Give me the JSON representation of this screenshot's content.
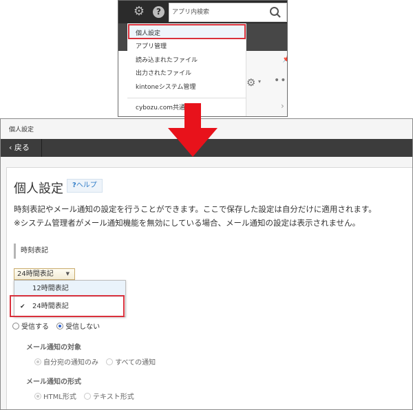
{
  "menu_snapshot": {
    "search_placeholder": "アプリ内検索",
    "items": [
      "個人設定",
      "アプリ管理",
      "読み込まれたファイル",
      "出力されたファイル",
      "kintoneシステム管理"
    ],
    "footer_item": "cybozu.com共通管理",
    "highlight_color": "#d9303b"
  },
  "page": {
    "title": "個人設定",
    "back_label": "戻る",
    "heading": "個人設定",
    "help_label": "ヘルプ",
    "help_mark": "?",
    "description_1": "時刻表記やメール通知の設定を行うことができます。ここで保存した設定は自分だけに適用されます。",
    "description_2": "※システム管理者がメール通知機能を無効にしている場合、メール通知の設定は表示されません。",
    "time_section": {
      "label": "時刻表記",
      "selected": "24時間表記",
      "options": [
        "12時間表記",
        "24時間表記"
      ]
    },
    "mail": {
      "receive_label": "受信する",
      "no_receive_label": "受信しない",
      "target_heading": "メール通知の対象",
      "target_options": [
        "自分宛の通知のみ",
        "すべての通知"
      ],
      "format_heading": "メール通知の形式",
      "format_options": [
        "HTML形式",
        "テキスト形式"
      ]
    }
  },
  "colors": {
    "accent": "#2f7cc7",
    "arrow": "#e8121b",
    "bar": "#3c3c3c"
  }
}
